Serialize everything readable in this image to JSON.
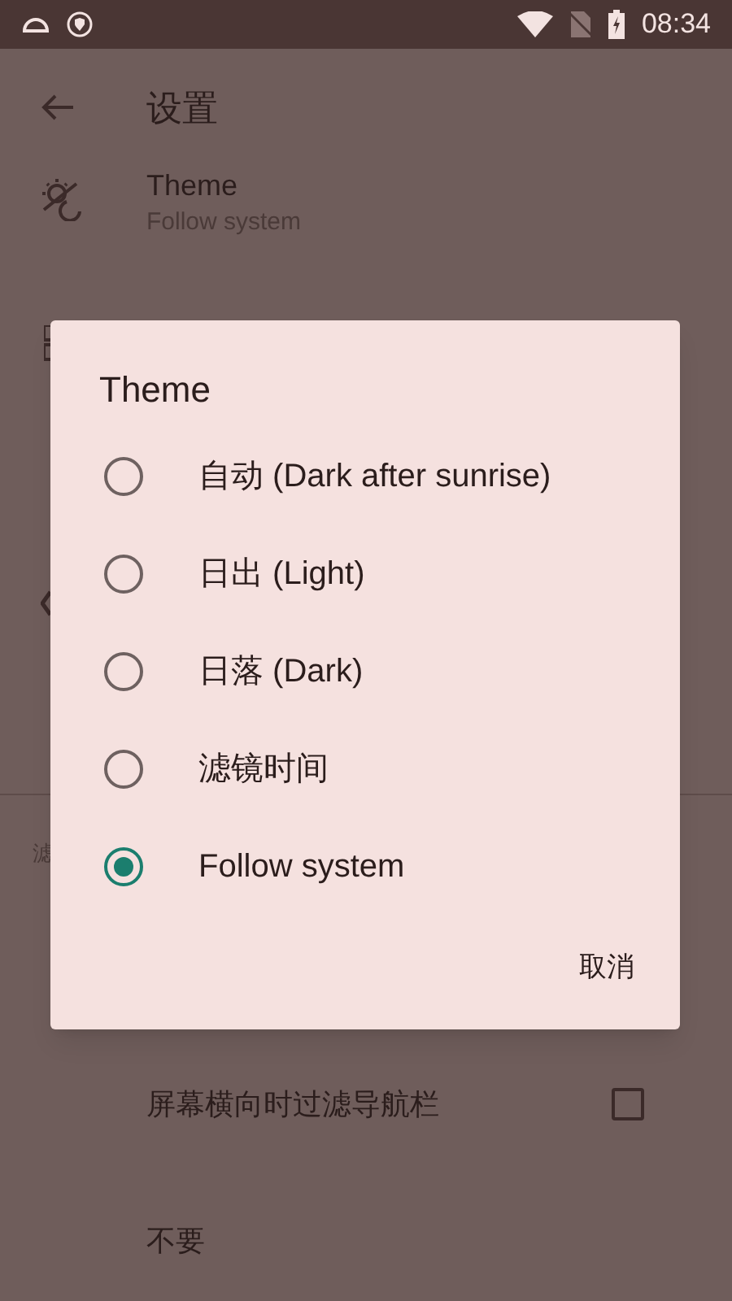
{
  "status_bar": {
    "time": "08:34"
  },
  "app_bar": {
    "title": "设置"
  },
  "settings": [
    {
      "title": "Theme",
      "subtitle": "Follow system"
    }
  ],
  "section_header": "滤",
  "lower_settings": [
    {
      "kind": "checkbox",
      "title": "屏幕横向时过滤导航栏",
      "checked": false
    },
    {
      "kind": "text",
      "title": "不要"
    }
  ],
  "dialog": {
    "title": "Theme",
    "options": [
      {
        "label": "自动 (Dark after sunrise)",
        "selected": false
      },
      {
        "label": "日出 (Light)",
        "selected": false
      },
      {
        "label": "日落 (Dark)",
        "selected": false
      },
      {
        "label": "滤镜时间",
        "selected": false
      },
      {
        "label": "Follow system",
        "selected": true
      }
    ],
    "buttons": [
      "取消"
    ]
  }
}
